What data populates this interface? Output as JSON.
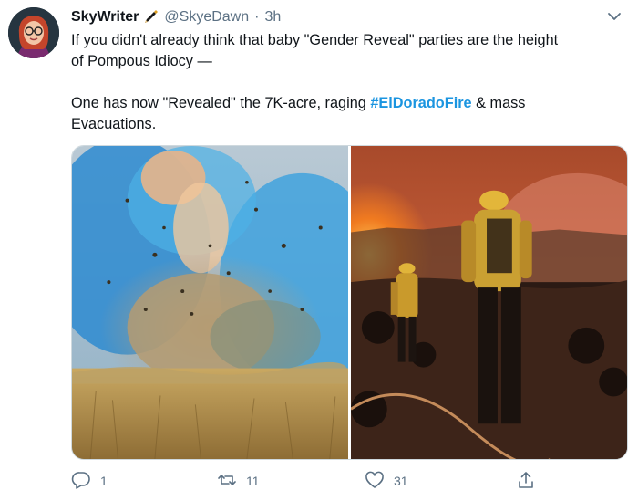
{
  "tweet": {
    "author_name": "SkyWriter",
    "handle": "@SkyeDawn",
    "separator": "·",
    "time": "3h",
    "paragraph1_line1": "If you didn't already think that baby \"Gender Reveal\" parties are the height",
    "paragraph1_line2": "of Pompous Idiocy —",
    "paragraph2_line1_before": "One has now \"Revealed\" the 7K-acre, raging ",
    "hashtag": "#ElDoradoFire",
    "paragraph2_line1_after": " & mass",
    "paragraph2_line2": "Evacuations."
  },
  "actions": {
    "reply_count": "1",
    "retweet_count": "11",
    "like_count": "31"
  },
  "colors": {
    "hashtag": "#1b95e0",
    "meta": "#5b7083"
  },
  "icons": [
    "pen-icon",
    "chevron-down-icon",
    "reply-icon",
    "retweet-icon",
    "like-icon",
    "share-icon"
  ]
}
